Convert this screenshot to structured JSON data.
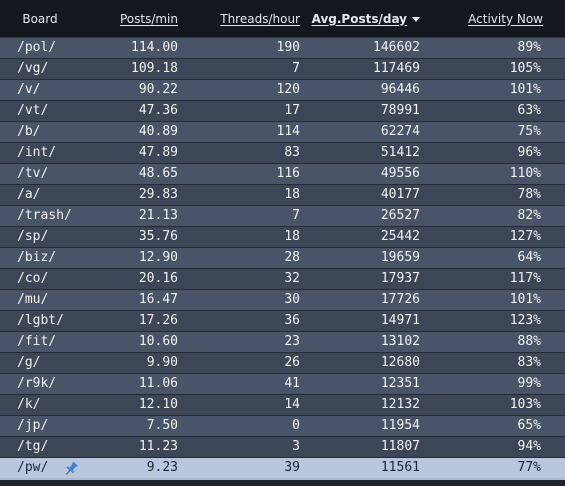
{
  "columns": {
    "board": "Board",
    "posts_min": "Posts/min",
    "threads_hour": "Threads/hour",
    "avg_posts_day": "Avg.Posts/day",
    "activity_now": "Activity Now"
  },
  "sort": {
    "column": "avg_posts_day",
    "direction": "descending"
  },
  "rows": [
    {
      "board": "/pol/",
      "posts_min": "114.00",
      "threads_hour": "190",
      "avg_posts_day": "146602",
      "activity": "89%"
    },
    {
      "board": "/vg/",
      "posts_min": "109.18",
      "threads_hour": "7",
      "avg_posts_day": "117469",
      "activity": "105%"
    },
    {
      "board": "/v/",
      "posts_min": "90.22",
      "threads_hour": "120",
      "avg_posts_day": "96446",
      "activity": "101%"
    },
    {
      "board": "/vt/",
      "posts_min": "47.36",
      "threads_hour": "17",
      "avg_posts_day": "78991",
      "activity": "63%"
    },
    {
      "board": "/b/",
      "posts_min": "40.89",
      "threads_hour": "114",
      "avg_posts_day": "62274",
      "activity": "75%"
    },
    {
      "board": "/int/",
      "posts_min": "47.89",
      "threads_hour": "83",
      "avg_posts_day": "51412",
      "activity": "96%"
    },
    {
      "board": "/tv/",
      "posts_min": "48.65",
      "threads_hour": "116",
      "avg_posts_day": "49556",
      "activity": "110%"
    },
    {
      "board": "/a/",
      "posts_min": "29.83",
      "threads_hour": "18",
      "avg_posts_day": "40177",
      "activity": "78%"
    },
    {
      "board": "/trash/",
      "posts_min": "21.13",
      "threads_hour": "7",
      "avg_posts_day": "26527",
      "activity": "82%"
    },
    {
      "board": "/sp/",
      "posts_min": "35.76",
      "threads_hour": "18",
      "avg_posts_day": "25442",
      "activity": "127%"
    },
    {
      "board": "/biz/",
      "posts_min": "12.90",
      "threads_hour": "28",
      "avg_posts_day": "19659",
      "activity": "64%"
    },
    {
      "board": "/co/",
      "posts_min": "20.16",
      "threads_hour": "32",
      "avg_posts_day": "17937",
      "activity": "117%"
    },
    {
      "board": "/mu/",
      "posts_min": "16.47",
      "threads_hour": "30",
      "avg_posts_day": "17726",
      "activity": "101%"
    },
    {
      "board": "/lgbt/",
      "posts_min": "17.26",
      "threads_hour": "36",
      "avg_posts_day": "14971",
      "activity": "123%"
    },
    {
      "board": "/fit/",
      "posts_min": "10.60",
      "threads_hour": "23",
      "avg_posts_day": "13102",
      "activity": "88%"
    },
    {
      "board": "/g/",
      "posts_min": "9.90",
      "threads_hour": "26",
      "avg_posts_day": "12680",
      "activity": "83%"
    },
    {
      "board": "/r9k/",
      "posts_min": "11.06",
      "threads_hour": "41",
      "avg_posts_day": "12351",
      "activity": "99%"
    },
    {
      "board": "/k/",
      "posts_min": "12.10",
      "threads_hour": "14",
      "avg_posts_day": "12132",
      "activity": "103%"
    },
    {
      "board": "/jp/",
      "posts_min": "7.50",
      "threads_hour": "0",
      "avg_posts_day": "11954",
      "activity": "65%"
    },
    {
      "board": "/tg/",
      "posts_min": "11.23",
      "threads_hour": "3",
      "avg_posts_day": "11807",
      "activity": "94%"
    },
    {
      "board": "/pw/",
      "posts_min": "9.23",
      "threads_hour": "39",
      "avg_posts_day": "11561",
      "activity": "77%",
      "pinned": true,
      "icon": "pushpin-icon"
    }
  ],
  "colors": {
    "header_bg": "#14171d",
    "row_odd": "#495468",
    "row_even": "#3d4656",
    "row_pinned": "#b8c7dd",
    "pin_blue": "#3f7fd6"
  }
}
